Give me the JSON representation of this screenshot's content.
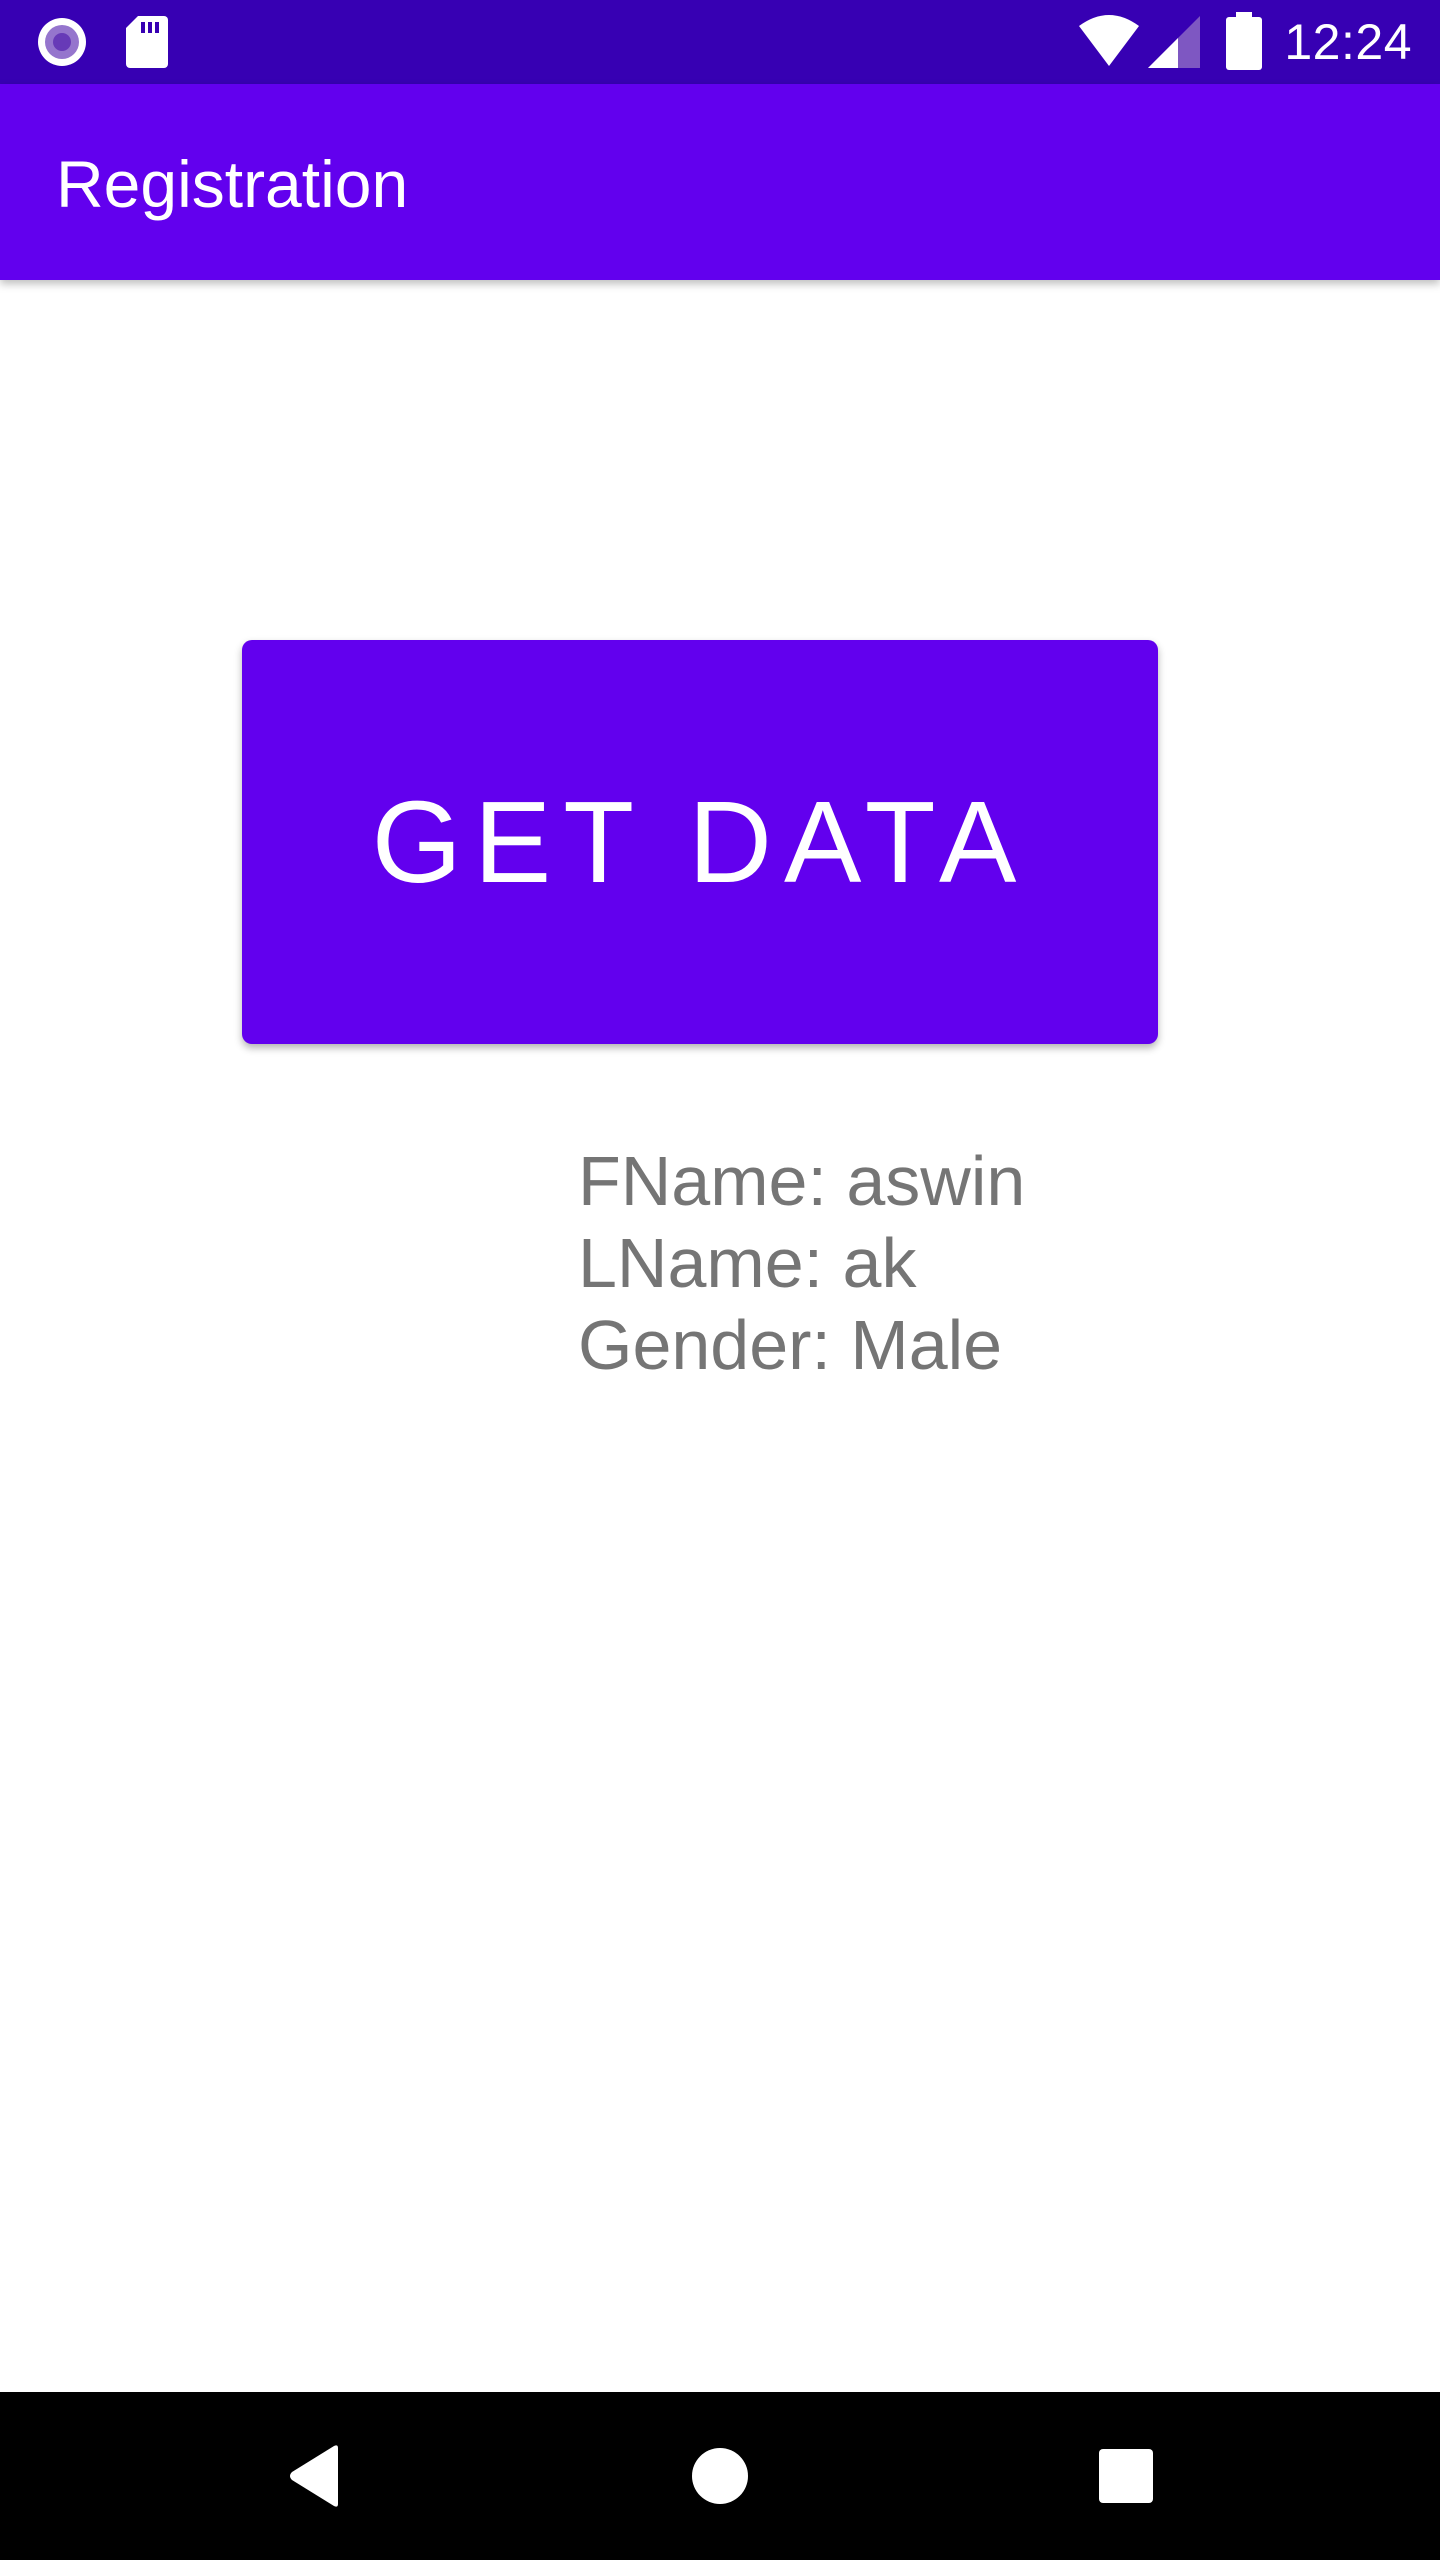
{
  "status_bar": {
    "time": "12:24",
    "icons": [
      "record-icon",
      "sd-card-icon",
      "wifi-icon",
      "cell-signal-icon",
      "battery-icon"
    ]
  },
  "app_bar": {
    "title": "Registration"
  },
  "main": {
    "button_label": "GET DATA",
    "results": {
      "fname": "FName: aswin",
      "lname": "LName: ak",
      "gender": "Gender: Male"
    }
  },
  "nav_bar": {
    "buttons": [
      "back-icon",
      "home-icon",
      "recents-icon"
    ]
  },
  "colors": {
    "status_bar": "#3700b3",
    "primary": "#6200ee",
    "text_secondary": "#757575"
  }
}
